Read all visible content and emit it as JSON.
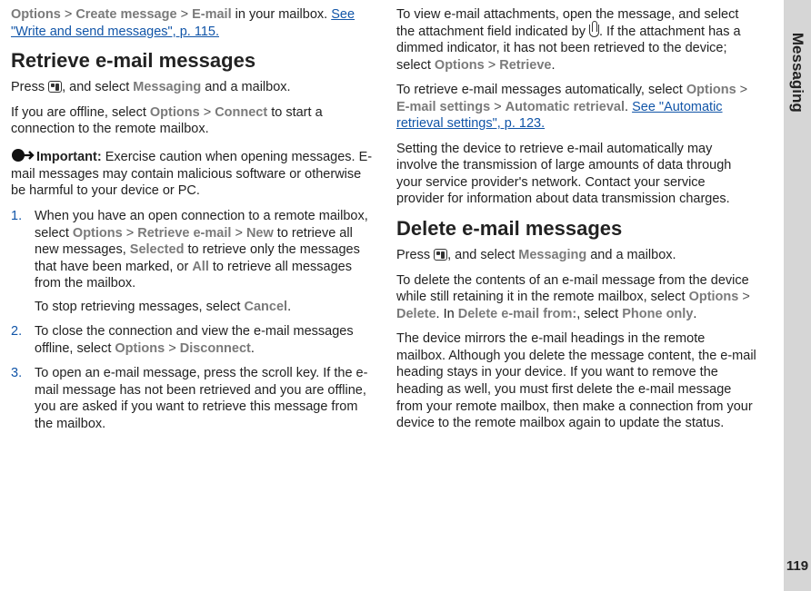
{
  "side": {
    "section": "Messaging",
    "page_number": "119"
  },
  "left": {
    "intro_pre": "Options",
    "intro_s1": ">",
    "intro_mid": "Create message",
    "intro_s2": ">",
    "intro_post": "E-mail",
    "intro_tail": " in your mailbox. ",
    "intro_link": "See \"Write and send messages\", p. 115.",
    "h_retrieve": "Retrieve e-mail messages",
    "press_a": "Press ",
    "press_b": ", and select ",
    "press_msg": "Messaging",
    "press_c": " and a mailbox.",
    "offline_a": "If you are offline, select ",
    "offline_opt": "Options",
    "offline_s": ">",
    "offline_con": "Connect",
    "offline_b": " to start a connection to the remote mailbox.",
    "imp_label": "Important:",
    "imp_text": " Exercise caution when opening messages. E-mail messages may contain malicious software or otherwise be harmful to your device or PC.",
    "li1_a": "When you have an open connection to a remote mailbox, select ",
    "li1_opt": "Options",
    "li1_s1": ">",
    "li1_ret": "Retrieve e-mail",
    "li1_s2": ">",
    "li1_new": "New",
    "li1_b": " to retrieve all new messages, ",
    "li1_sel": "Selected",
    "li1_c": " to retrieve only the messages that have been marked, or ",
    "li1_all": "All",
    "li1_d": " to retrieve all messages from the mailbox.",
    "li1_sub_a": "To stop retrieving messages, select ",
    "li1_sub_cancel": "Cancel",
    "li1_sub_b": ".",
    "li2_a": "To close the connection and view the e-mail messages offline, select ",
    "li2_opt": "Options",
    "li2_s": ">",
    "li2_dis": "Disconnect",
    "li2_b": ".",
    "li3": "To open an e-mail message, press the scroll key. If the e-mail message has not been retrieved and you are offline, you are asked if you want to retrieve this message from the mailbox."
  },
  "right": {
    "p1_a": "To view e-mail attachments, open the message, and select the attachment field indicated by ",
    "p1_b": ". If the attachment has a dimmed indicator, it has not been retrieved to the device; select ",
    "p1_opt": "Options",
    "p1_s": ">",
    "p1_ret": "Retrieve",
    "p1_c": ".",
    "p2_a": "To retrieve e-mail messages automatically, select ",
    "p2_opt": "Options",
    "p2_s1": ">",
    "p2_es": "E-mail settings",
    "p2_s2": ">",
    "p2_auto": "Automatic retrieval",
    "p2_b": ". ",
    "p2_link": "See \"Automatic retrieval settings\", p. 123.",
    "p3": "Setting the device to retrieve e-mail automatically may involve the transmission of large amounts of data through your service provider's network. Contact your service provider for information about data transmission charges.",
    "h_delete": "Delete e-mail messages",
    "press_a": "Press ",
    "press_b": ", and select ",
    "press_msg": "Messaging",
    "press_c": " and a mailbox.",
    "p4_a": "To delete the contents of an e-mail message from the device while still retaining it in the remote mailbox, select ",
    "p4_opt": "Options",
    "p4_s": ">",
    "p4_del": "Delete",
    "p4_b": ". In ",
    "p4_from": "Delete e-mail from:",
    "p4_c": ", select ",
    "p4_phone": "Phone only",
    "p4_d": ".",
    "p5": "The device mirrors the e-mail headings in the remote mailbox. Although you delete the message content, the e-mail heading stays in your device. If you want to remove the heading as well, you must first delete the e-mail message from your remote mailbox, then make a connection from your device to the remote mailbox again to update the status."
  }
}
